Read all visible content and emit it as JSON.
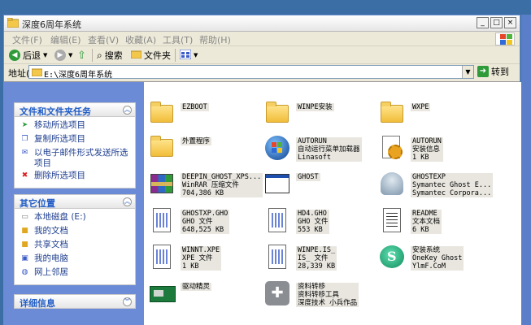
{
  "window": {
    "title": "深度6周年系统",
    "buttons": {
      "minimize": "_",
      "maximize": "□",
      "close": "×"
    }
  },
  "menu": [
    "文件(F)",
    "编辑(E)",
    "查看(V)",
    "收藏(A)",
    "工具(T)",
    "帮助(H)"
  ],
  "toolbar": {
    "back": "后退",
    "search": "搜索",
    "folders": "文件夹"
  },
  "address": {
    "label": "地址(D)",
    "path": "E:\\深度6周年系统",
    "go": "转到"
  },
  "sidebar": {
    "tasks": {
      "title": "文件和文件夹任务",
      "items": [
        "移动所选项目",
        "复制所选项目",
        "以电子邮件形式发送所选项目",
        "删除所选项目"
      ]
    },
    "places": {
      "title": "其它位置",
      "items": [
        "本地磁盘 (E:)",
        "我的文档",
        "共享文档",
        "我的电脑",
        "网上邻居"
      ]
    },
    "details": {
      "title": "详细信息"
    }
  },
  "files": [
    {
      "icon": "folder-icon",
      "lines": [
        "EZBOOT"
      ]
    },
    {
      "icon": "folder-icon",
      "lines": [
        "WINPE安装"
      ]
    },
    {
      "icon": "folder-icon",
      "lines": [
        "WXPE"
      ]
    },
    {
      "icon": "folder-icon",
      "lines": [
        "外置程序"
      ]
    },
    {
      "icon": "autorun-icon",
      "lines": [
        "AUTORUN",
        "自动运行菜单加载器",
        "Linasoft"
      ]
    },
    {
      "icon": "setup-info-icon",
      "lines": [
        "AUTORUN",
        "安装信息",
        "1 KB"
      ]
    },
    {
      "icon": "winrar-icon",
      "lines": [
        "DEEPIN_GHOST_XPS...",
        "WinRAR 压缩文件",
        "704,386 KB"
      ]
    },
    {
      "icon": "window-icon",
      "lines": [
        "GHOST"
      ]
    },
    {
      "icon": "ghost-icon",
      "lines": [
        "GHOSTEXP",
        "Symantec Ghost E...",
        "Symantec Corpora..."
      ]
    },
    {
      "icon": "gho-file-icon",
      "lines": [
        "GHOSTXP.GHO",
        "GHO 文件",
        "648,525 KB"
      ]
    },
    {
      "icon": "gho-file-icon",
      "lines": [
        "HD4.GHO",
        "GHO 文件",
        "553 KB"
      ]
    },
    {
      "icon": "text-file-icon",
      "lines": [
        "README",
        "文本文档",
        "6 KB"
      ]
    },
    {
      "icon": "gho-file-icon",
      "lines": [
        "WINNT.XPE",
        "XPE 文件",
        "1 KB"
      ]
    },
    {
      "icon": "gho-file-icon",
      "lines": [
        "WINPE.IS_",
        "IS_ 文件",
        "28,339 KB"
      ]
    },
    {
      "icon": "onekey-ghost-icon",
      "lines": [
        "安装系统",
        "OneKey Ghost",
        "YlmF.CoM"
      ]
    },
    {
      "icon": "driver-icon",
      "lines": [
        "驱动精灵"
      ]
    },
    {
      "icon": "user-transfer-icon",
      "lines": [
        "资料转移",
        "资料转移工具",
        "深度技术 小兵作品"
      ]
    }
  ]
}
